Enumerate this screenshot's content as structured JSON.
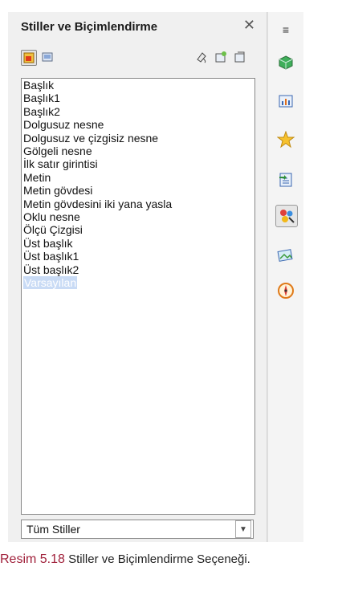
{
  "panel": {
    "title": "Stiller ve Biçimlendirme",
    "close_icon": "close-icon",
    "toolbar": {
      "left": [
        "graphics-styles-icon",
        "presentation-styles-icon"
      ],
      "right": [
        "fill-format-mode-icon",
        "new-style-from-selection-icon",
        "update-style-icon"
      ]
    },
    "styles": [
      "Başlık",
      "Başlık1",
      "Başlık2",
      "Dolgusuz nesne",
      "Dolgusuz ve çizgisiz nesne",
      "Gölgeli nesne",
      "İlk satır girintisi",
      "Metin",
      "Metin gövdesi",
      "Metin gövdesini iki yana yasla",
      "Oklu nesne",
      "Ölçü Çizgisi",
      "Üst başlık",
      "Üst başlık1",
      "Üst başlık2",
      "Varsayılan"
    ],
    "selected_style": "Varsayılan",
    "filter_value": "Tüm Stiller"
  },
  "sidebar": {
    "menu_icon": "sidebar-menu-icon",
    "buttons": [
      "properties-icon",
      "slide-transition-icon",
      "custom-animation-icon",
      "master-pages-icon",
      "styles-and-formatting-icon",
      "gallery-icon",
      "navigator-icon"
    ],
    "active": "styles-and-formatting-icon"
  },
  "caption": {
    "number": "Resim 5.18",
    "text": "Stiller ve Biçimlendirme Seçeneği."
  },
  "colors": {
    "panel_bg": "#f0f0f0",
    "selection_bg": "#c9dbf5",
    "caption_accent": "#a0203a"
  }
}
